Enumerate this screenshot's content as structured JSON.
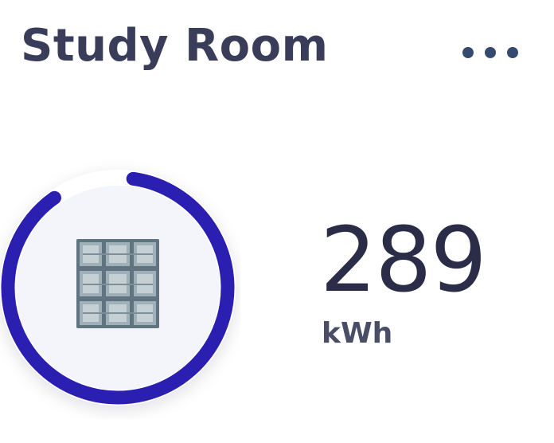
{
  "card": {
    "title": "Study Room",
    "more_icon": "more-horizontal-icon",
    "device_icon": "radiator-icon"
  },
  "energy": {
    "value": "289",
    "unit": "kWh",
    "ring_progress_percent": 88
  },
  "colors": {
    "accent": "#2a1fb0",
    "text_dark": "#2a2c48",
    "icon_muted": "#5f7480",
    "ring_bg": "#f3f3fb"
  }
}
